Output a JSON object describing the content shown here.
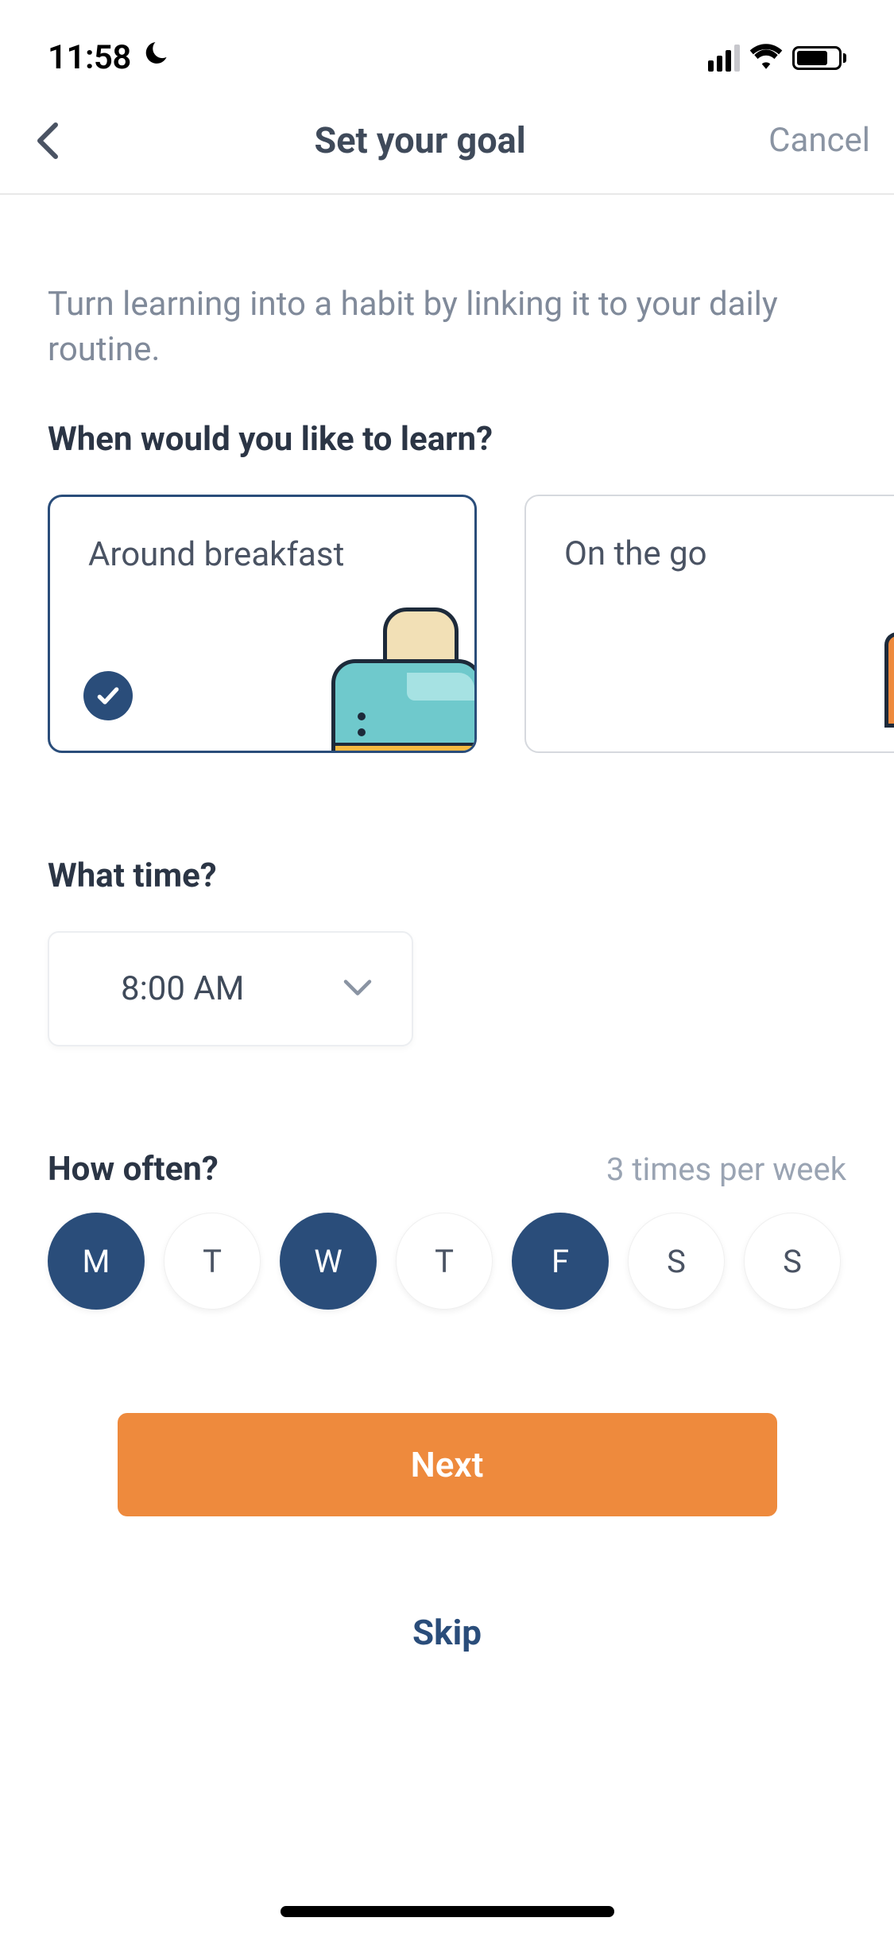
{
  "status": {
    "time": "11:58"
  },
  "nav": {
    "title": "Set your goal",
    "cancel": "Cancel"
  },
  "intro": "Turn learning into a habit by linking it to your daily routine.",
  "questions": {
    "when": "When would you like to learn?",
    "time": "What time?",
    "often": "How often?"
  },
  "options": [
    {
      "label": "Around breakfast",
      "selected": true
    },
    {
      "label": "On the go",
      "selected": false
    }
  ],
  "time_value": "8:00 AM",
  "frequency_label": "3 times per week",
  "days": [
    {
      "label": "M",
      "selected": true
    },
    {
      "label": "T",
      "selected": false
    },
    {
      "label": "W",
      "selected": true
    },
    {
      "label": "T",
      "selected": false
    },
    {
      "label": "F",
      "selected": true
    },
    {
      "label": "S",
      "selected": false
    },
    {
      "label": "S",
      "selected": false
    }
  ],
  "buttons": {
    "next": "Next",
    "skip": "Skip"
  }
}
